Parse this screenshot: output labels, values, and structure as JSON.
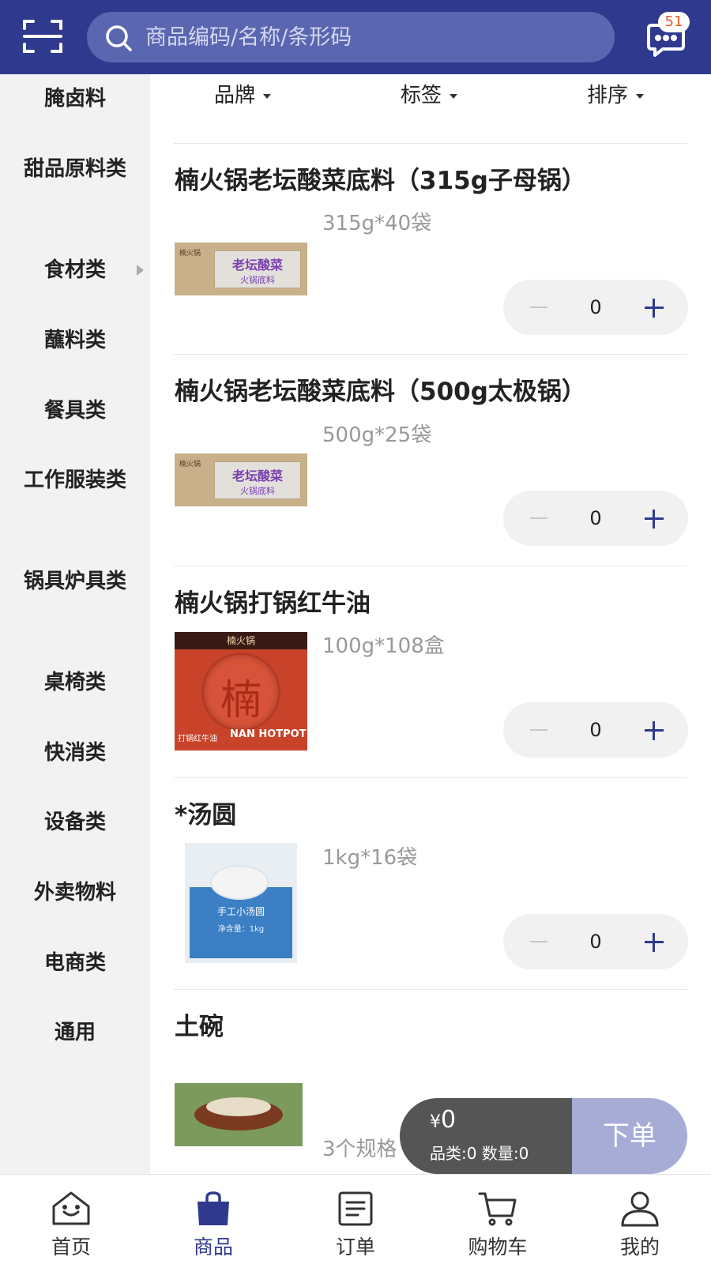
{
  "header": {
    "search_placeholder": "商品编码/名称/条形码",
    "message_count": "51"
  },
  "sidebar": {
    "items": [
      {
        "label": "腌卤料"
      },
      {
        "label": "甜品原料类"
      },
      {
        "label": "食材类"
      },
      {
        "label": "蘸料类"
      },
      {
        "label": "餐具类"
      },
      {
        "label": "工作服装类"
      },
      {
        "label": "锅具炉具类"
      },
      {
        "label": "桌椅类"
      },
      {
        "label": "快消类"
      },
      {
        "label": "设备类"
      },
      {
        "label": "外卖物料"
      },
      {
        "label": "电商类"
      },
      {
        "label": "通用"
      }
    ]
  },
  "filters": {
    "brand": "品牌",
    "tag": "标签",
    "sort": "排序"
  },
  "products": [
    {
      "name": "楠火锅老坛酸菜底料（315g子母锅）",
      "spec": "315g*40袋",
      "quantity": "0",
      "image_text": "老坛酸菜",
      "image_subtext": "火锅底料",
      "image_brand": "楠火锅"
    },
    {
      "name": "楠火锅老坛酸菜底料（500g太极锅）",
      "spec": "500g*25袋",
      "quantity": "0",
      "image_text": "老坛酸菜",
      "image_subtext": "火锅底料",
      "image_brand": "楠火锅"
    },
    {
      "name": "楠火锅打锅红牛油",
      "spec": "100g*108盒",
      "quantity": "0",
      "image_text": "楠",
      "image_subtext": "打锅红牛油",
      "image_brand": "楠火锅",
      "image_label": "NAN HOTPOT"
    },
    {
      "name": "*汤圆",
      "spec": "1kg*16袋",
      "quantity": "0",
      "image_text": "手工小汤圆",
      "image_subtext": "净含量：1kg"
    },
    {
      "name": "土碗",
      "spec": "3个规格"
    }
  ],
  "cart": {
    "currency": "¥",
    "total": "0",
    "category_label": "品类:",
    "category_count": "0",
    "qty_label": "数量:",
    "qty_count": "0",
    "order_label": "下单"
  },
  "tabs": [
    {
      "label": "首页"
    },
    {
      "label": "商品"
    },
    {
      "label": "订单"
    },
    {
      "label": "购物车"
    },
    {
      "label": "我的"
    }
  ],
  "colors": {
    "primary": "#2f3a8f",
    "cart_bg": "#555555",
    "order_btn": "#a7acd7"
  }
}
